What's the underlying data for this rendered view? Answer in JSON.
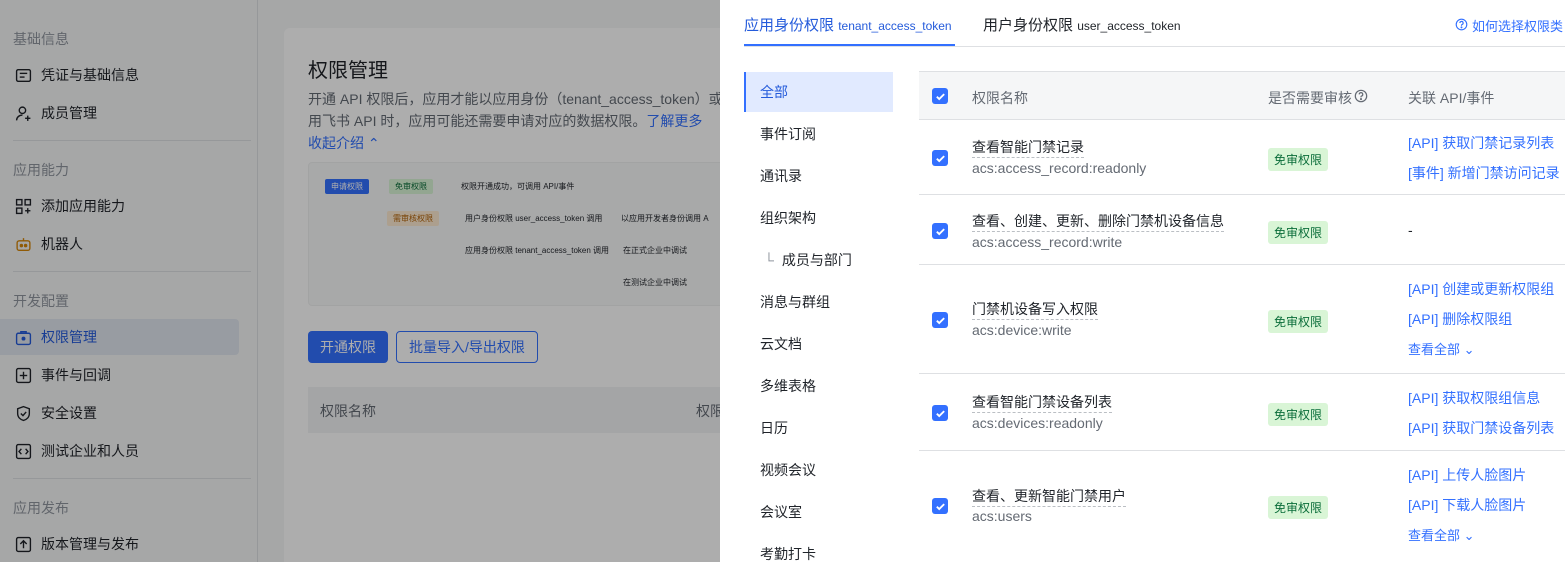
{
  "sidebar": {
    "groups": [
      {
        "title": "基础信息",
        "items": [
          "凭证与基础信息",
          "成员管理"
        ]
      },
      {
        "title": "应用能力",
        "items": [
          "添加应用能力",
          "机器人"
        ]
      },
      {
        "title": "开发配置",
        "items": [
          "权限管理",
          "事件与回调",
          "安全设置",
          "测试企业和人员"
        ]
      },
      {
        "title": "应用发布",
        "items": [
          "版本管理与发布"
        ]
      }
    ],
    "active_item": "权限管理"
  },
  "main": {
    "title": "权限管理",
    "desc_line1": "开通 API 权限后，应用才能以应用身份（tenant_access_token）或",
    "desc_line2": "用飞书 API 时，应用可能还需要申请对应的数据权限。",
    "learn_more": "了解更多",
    "collapse": "收起介绍",
    "flow": {
      "apply": "申请权限",
      "no_review": "免审权限",
      "success": "权限开通成功，可调用 API/事件",
      "need_review": "需审核权限",
      "user_token": "用户身份权限 user_access_token 调用",
      "dev_call": "以应用开发者身份调用 A",
      "app_token": "应用身份权限 tenant_access_token 调用",
      "prod": "在正式企业中调试",
      "test": "在测试企业中调试"
    },
    "enable_button": "开通权限",
    "bulk_button": "批量导入/导出权限",
    "col_name": "权限名称",
    "col_other": "权限"
  },
  "drawer": {
    "tabs": [
      {
        "label": "应用身份权限",
        "sub": "tenant_access_token"
      },
      {
        "label": "用户身份权限",
        "sub": "user_access_token"
      }
    ],
    "help": "如何选择权限类",
    "categories": [
      "全部",
      "事件订阅",
      "通讯录",
      "组织架构",
      "成员与部门",
      "消息与群组",
      "云文档",
      "多维表格",
      "日历",
      "视频会议",
      "会议室",
      "考勤打卡"
    ],
    "table": {
      "col_name": "权限名称",
      "col_review": "是否需要审核",
      "col_api": "关联 API/事件",
      "rows": [
        {
          "name": "查看智能门禁记录",
          "code": "acs:access_record:readonly",
          "badge": "免审权限",
          "apis": [
            "[API] 获取门禁记录列表",
            "[事件] 新增门禁访问记录"
          ]
        },
        {
          "name": "查看、创建、更新、删除门禁机设备信息",
          "code": "acs:access_record:write",
          "badge": "免审权限",
          "apis": [
            "-"
          ]
        },
        {
          "name": "门禁机设备写入权限",
          "code": "acs:device:write",
          "badge": "免审权限",
          "apis": [
            "[API] 创建或更新权限组",
            "[API] 删除权限组",
            "查看全部"
          ]
        },
        {
          "name": "查看智能门禁设备列表",
          "code": "acs:devices:readonly",
          "badge": "免审权限",
          "apis": [
            "[API] 获取权限组信息",
            "[API] 获取门禁设备列表"
          ]
        },
        {
          "name": "查看、更新智能门禁用户",
          "code": "acs:users",
          "badge": "免审权限",
          "apis": [
            "[API] 上传人脸图片",
            "[API] 下载人脸图片",
            "查看全部"
          ]
        }
      ]
    }
  }
}
